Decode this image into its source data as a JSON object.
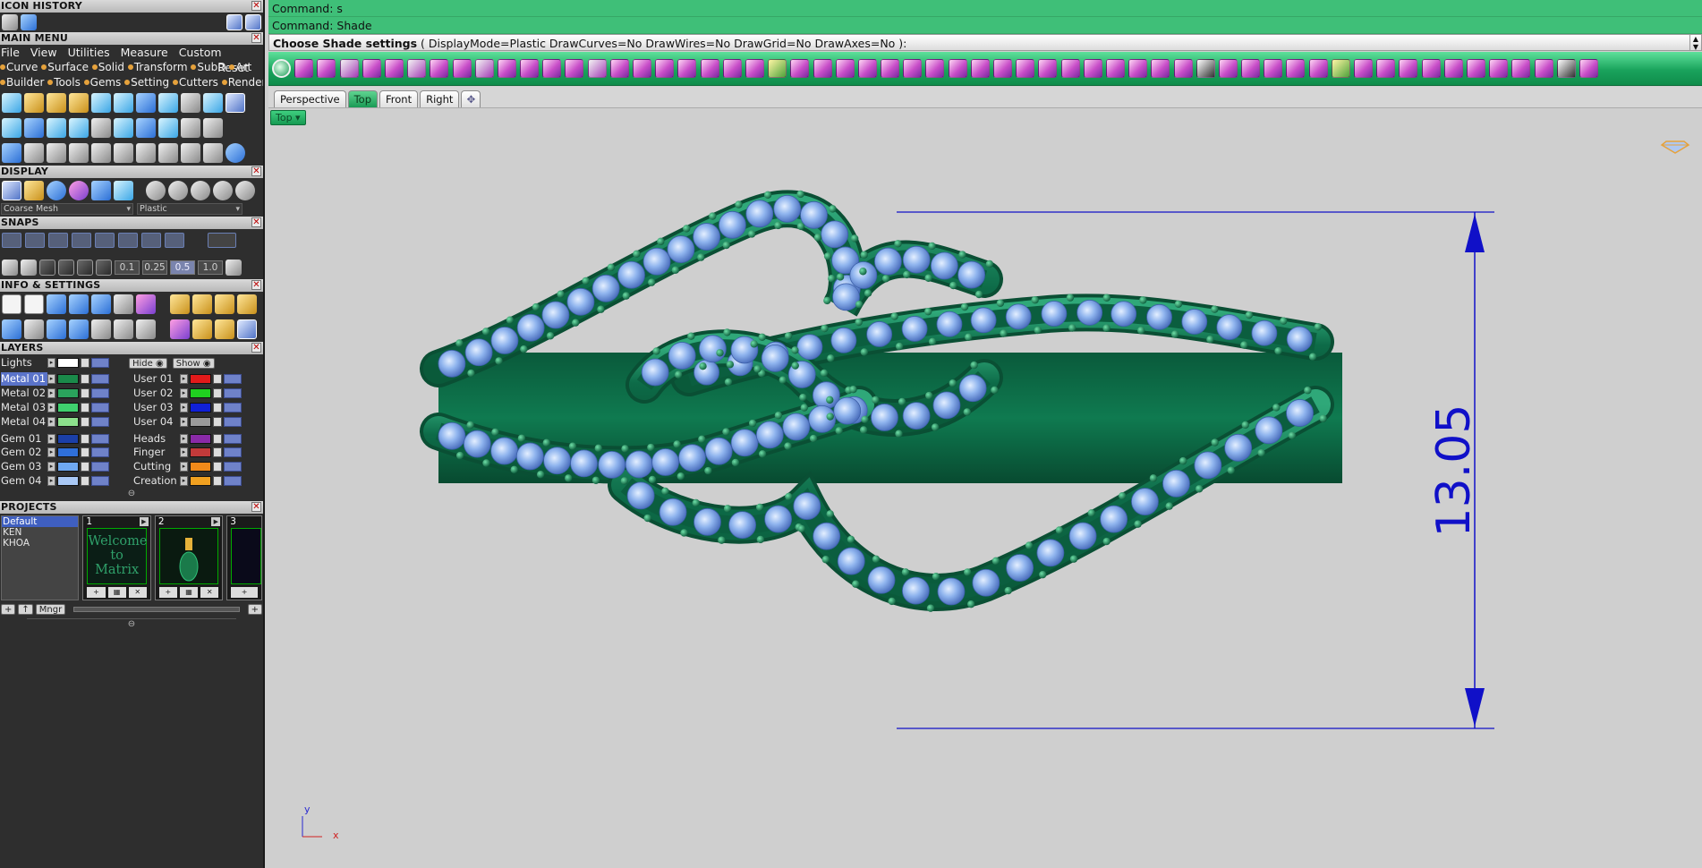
{
  "left_panel": {
    "sections": {
      "icon_history": "ICON HISTORY",
      "main_menu": "MAIN MENU",
      "display": "DISPLAY",
      "snaps": "SNAPS",
      "info_settings": "INFO & SETTINGS",
      "layers": "LAYERS",
      "projects": "PROJECTS"
    },
    "menu_row1": [
      "File",
      "View",
      "Utilities",
      "Measure",
      "Custom"
    ],
    "menu_reset": "Reset",
    "category_row1": [
      "Curve",
      "Surface",
      "Solid",
      "Transform",
      "SubD",
      "Art"
    ],
    "category_row2": [
      "Builder",
      "Tools",
      "Gems",
      "Setting",
      "Cutters",
      "Render"
    ],
    "display_combo1": "Coarse Mesh",
    "display_combo2": "Plastic",
    "snap_values": [
      "0.1",
      "0.25",
      "0.5",
      "1.0"
    ],
    "snap_selected": "0.5",
    "layers": {
      "lights_label": "Lights",
      "hide_label": "Hide",
      "show_label": "Show",
      "left": [
        {
          "name": "Metal 01",
          "color": "#1a8a4a",
          "selected": true
        },
        {
          "name": "Metal 02",
          "color": "#2aa35c"
        },
        {
          "name": "Metal 03",
          "color": "#3fd06e"
        },
        {
          "name": "Metal 04",
          "color": "#8ce08c"
        },
        {
          "name": "Gem 01",
          "color": "#1b3fa8"
        },
        {
          "name": "Gem 02",
          "color": "#2f6fd8"
        },
        {
          "name": "Gem 03",
          "color": "#6fa8f0"
        },
        {
          "name": "Gem 04",
          "color": "#a9c8f5"
        }
      ],
      "right": [
        {
          "name": "User 01",
          "color": "#e21a1a"
        },
        {
          "name": "User 02",
          "color": "#20d020"
        },
        {
          "name": "User 03",
          "color": "#1020d8"
        },
        {
          "name": "User 04",
          "color": "#9a9a9a"
        },
        {
          "name": "Heads",
          "color": "#8a2aa8"
        },
        {
          "name": "Finger",
          "color": "#c23a3a"
        },
        {
          "name": "Cutting",
          "color": "#f08a1a"
        },
        {
          "name": "Creation",
          "color": "#f0a020"
        }
      ]
    },
    "projects": {
      "list": [
        "Default",
        "KEN",
        "KHOA"
      ],
      "thumbs": [
        {
          "num": "1",
          "text": "Welcome to Matrix"
        },
        {
          "num": "2",
          "text": ""
        },
        {
          "num": "3",
          "text": ""
        }
      ],
      "manager_label": "Mngr"
    }
  },
  "command": {
    "line1": "Command: s",
    "line2": "Command: Shade",
    "prompt_bold": "Choose Shade settings",
    "prompt_rest": " ( DisplayMode=Plastic  DrawCurves=No  DrawWires=No  DrawGrid=No  DrawAxes=No ):"
  },
  "tabs": [
    "Perspective",
    "Top",
    "Front",
    "Right"
  ],
  "active_tab": "Top",
  "viewport": {
    "label": "Top",
    "dimension_value": "13.05",
    "axis_y": "y",
    "axis_x": "x"
  },
  "colors": {
    "accent_green": "#3fbf78",
    "metal": "#0e6e4c",
    "gem": "#8fb4ee",
    "dimension": "#1010c8"
  }
}
